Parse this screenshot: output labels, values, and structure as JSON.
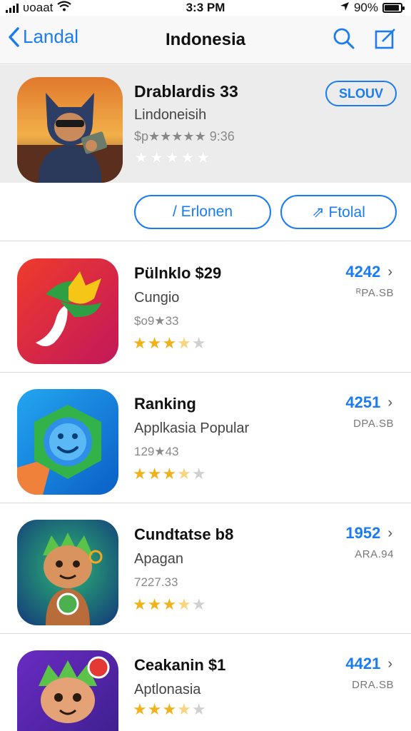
{
  "status_bar": {
    "carrier": "ʋoaat",
    "time": "3:3 PM",
    "battery": "90%",
    "battery_level": 0.9
  },
  "nav": {
    "back_label": "Landal",
    "title": "Indonesia"
  },
  "featured": {
    "title": "Drablardis 33",
    "subtitle": "Lindoneisih",
    "meta": "$p★★★★★ 9:36",
    "stars": "★★★★★",
    "button_label": "SLOUV"
  },
  "actions": {
    "left_label": "/ Erlonen",
    "right_label": "⇗ Ftolal"
  },
  "apps": [
    {
      "name": "Pülnklo $29",
      "category": "Cungio",
      "meta": "$o9★33",
      "rank": "4242",
      "size": "ᴿPA.SB",
      "rating": 3.5
    },
    {
      "name": "Ranking",
      "category": "Applkasia Popular",
      "meta": "129★43",
      "rank": "4251",
      "size": "DPA.SB",
      "rating": 3.5
    },
    {
      "name": "Cundtatse b8",
      "category": "Apagan",
      "meta": "7227.33",
      "rank": "1952",
      "size": "ARA.94",
      "rating": 3.5
    },
    {
      "name": "Ceakanin $1",
      "category": "Aptlonasia",
      "meta": "",
      "rank": "4421",
      "size": "DRA.SB",
      "rating": 3.5
    }
  ]
}
